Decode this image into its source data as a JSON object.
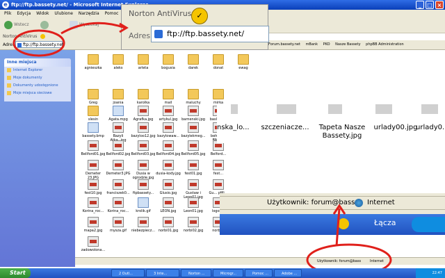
{
  "window": {
    "title": "ftp://ftp.bassety.net/ - Microsoft Internet Explorer"
  },
  "menu": [
    "Plik",
    "Edycja",
    "Widok",
    "Ulubione",
    "Narzędzia",
    "Pomoc"
  ],
  "toolbar": {
    "back_label": "Wstecz",
    "search_label": "Wyszukaj"
  },
  "norton": {
    "label": "Norton AntiVirus"
  },
  "address": {
    "label": "Adres",
    "value": "ftp://ftp.bassety.net/"
  },
  "favorites": [
    "Forum.bassety.net",
    "mBank",
    "PKO",
    "Nasze Bassety",
    "phpBB Administration"
  ],
  "leftpane": {
    "title": "Inne miejsca",
    "items": [
      "Internet Explorer",
      "Moje dokumenty",
      "Dokumenty udostępnione",
      "Moje miejsca sieciowe"
    ]
  },
  "files": [
    {
      "name": "agnieszka",
      "t": "folder"
    },
    {
      "name": "aleks",
      "t": "folder"
    },
    {
      "name": "arleta",
      "t": "folder"
    },
    {
      "name": "bogusia",
      "t": "folder"
    },
    {
      "name": "darek",
      "t": "folder"
    },
    {
      "name": "donat",
      "t": "folder"
    },
    {
      "name": "ewag",
      "t": "folder"
    },
    {
      "name": "Greg",
      "t": "folder"
    },
    {
      "name": "joania",
      "t": "folder"
    },
    {
      "name": "karolka",
      "t": "folder"
    },
    {
      "name": "mail",
      "t": "folder"
    },
    {
      "name": "maluchy",
      "t": "folder"
    },
    {
      "name": "mirka",
      "t": "folder"
    },
    {
      "name": "slesin",
      "t": "folder"
    },
    {
      "name": "Agata.mpg",
      "t": "other"
    },
    {
      "name": "Agrafka.jpg",
      "t": "jpg"
    },
    {
      "name": "artykul.jpg",
      "t": "jpg"
    },
    {
      "name": "barnenski.jpg",
      "t": "jpg"
    },
    {
      "name": "bas01.jpg",
      "t": "jpg"
    },
    {
      "name": "bas02.jpg",
      "t": "jpg"
    },
    {
      "name": "bassety.bmp",
      "t": "other"
    },
    {
      "name": "Bazyli Atka_.jpg",
      "t": "jpg"
    },
    {
      "name": "bazyloo12.jpg",
      "t": "jpg"
    },
    {
      "name": "bazylowaw...",
      "t": "jpg"
    },
    {
      "name": "bazylekmeg...",
      "t": "jpg"
    },
    {
      "name": "behavior BM.jpg",
      "t": "jpg"
    },
    {
      "name": "Bellford01.jpg",
      "t": "jpg"
    },
    {
      "name": "Bellford02.jpg",
      "t": "jpg"
    },
    {
      "name": "Bellford03.jpg",
      "t": "jpg"
    },
    {
      "name": "Bellford04.jpg",
      "t": "jpg"
    },
    {
      "name": "Bellford05.jpg",
      "t": "jpg"
    },
    {
      "name": "Belford...",
      "t": "jpg"
    },
    {
      "name": "Demeter 23.JPG",
      "t": "jpg"
    },
    {
      "name": "Demeter3.JPG",
      "t": "jpg"
    },
    {
      "name": "Dusia w ogrodzie.jpg",
      "t": "jpg"
    },
    {
      "name": "dusia-kody.jpg",
      "t": "jpg"
    },
    {
      "name": "fest01.jpg",
      "t": "jpg"
    },
    {
      "name": "fest...",
      "t": "jpg"
    },
    {
      "name": "fest10.jpg",
      "t": "jpg"
    },
    {
      "name": "franciszek0...",
      "t": "jpg"
    },
    {
      "name": "ftpbassety...",
      "t": "jpg"
    },
    {
      "name": "Glusio.jpg",
      "t": "jpg"
    },
    {
      "name": "Gustaw i Leon01.jpg",
      "t": "jpg"
    },
    {
      "name": "Gu... pMi...",
      "t": "jpg"
    },
    {
      "name": "Korina_roc...",
      "t": "jpg"
    },
    {
      "name": "Korina_roc...",
      "t": "jpg"
    },
    {
      "name": "krolik.gif",
      "t": "other"
    },
    {
      "name": "LEON.jpg",
      "t": "jpg"
    },
    {
      "name": "Leon01.jpg",
      "t": "jpg"
    },
    {
      "name": "logoz...",
      "t": "jpg"
    },
    {
      "name": "mapa2.jpg",
      "t": "jpg"
    },
    {
      "name": "mysza.gif",
      "t": "jpg"
    },
    {
      "name": "niebezpiecz...",
      "t": "jpg"
    },
    {
      "name": "norbi01.jpg",
      "t": "jpg"
    },
    {
      "name": "norbi02.jpg",
      "t": "jpg"
    },
    {
      "name": "norbi...",
      "t": "jpg"
    },
    {
      "name": "zadowolona...",
      "t": "jpg"
    }
  ],
  "zoom_thumbs": [
    "nska_lo...",
    "szczeniacze...",
    "Tapeta Nasze Bassety.jpg",
    "urlady00.jpg",
    "urlady0..."
  ],
  "status": {
    "user": "Użytkownik: forum@bass",
    "zone": "Internet"
  },
  "tray": {
    "links": "Łącza",
    "time": "22:47"
  },
  "taskbar": {
    "start": "Start",
    "tasks": [
      "2 Outl...",
      "3 Inte...",
      "Norton ...",
      "Microgr...",
      "Pomoc ...",
      "Adobe ..."
    ]
  }
}
